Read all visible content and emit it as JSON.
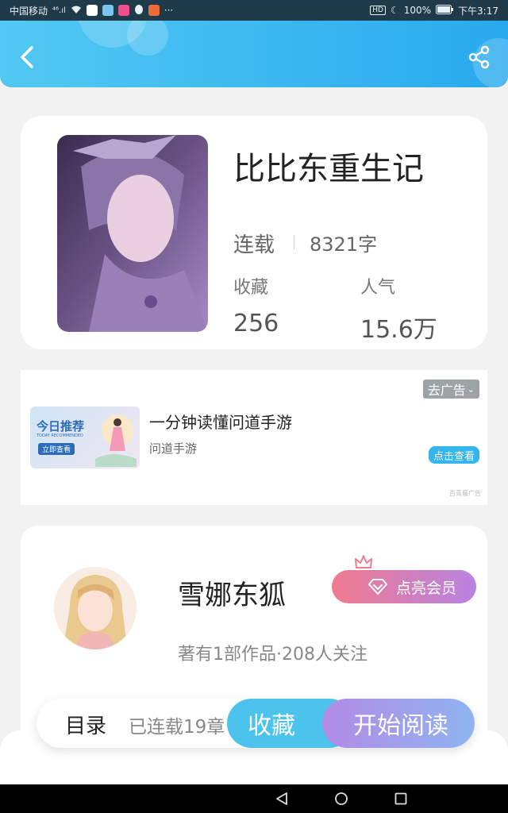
{
  "status_bar": {
    "carrier": "中国移动",
    "signal": "⁴⁶.ıl",
    "more": "···",
    "battery": "100%",
    "time": "下午3:17"
  },
  "book": {
    "title": "比比东重生记",
    "status": "连载",
    "word_count": "8321字",
    "fav_label": "收藏",
    "fav_value": "256",
    "pop_label": "人气",
    "pop_value": "15.6万"
  },
  "ad": {
    "remove_label": "去广告",
    "image_title": "今日推荐",
    "image_subtitle": "TODAY RECOMMENDED",
    "image_button": "立即查看",
    "title": "一分钟读懂问道手游",
    "subtitle": "问道手游",
    "cta": "点击查看",
    "source": "百青藤广告"
  },
  "author": {
    "name": "雪娜东狐",
    "vip_label": "点亮会员",
    "meta": "著有1部作品·208人关注"
  },
  "bottom_bar": {
    "toc_label": "目录",
    "toc_status": "已连载19章",
    "fav_button": "收藏",
    "read_button": "开始阅读"
  }
}
